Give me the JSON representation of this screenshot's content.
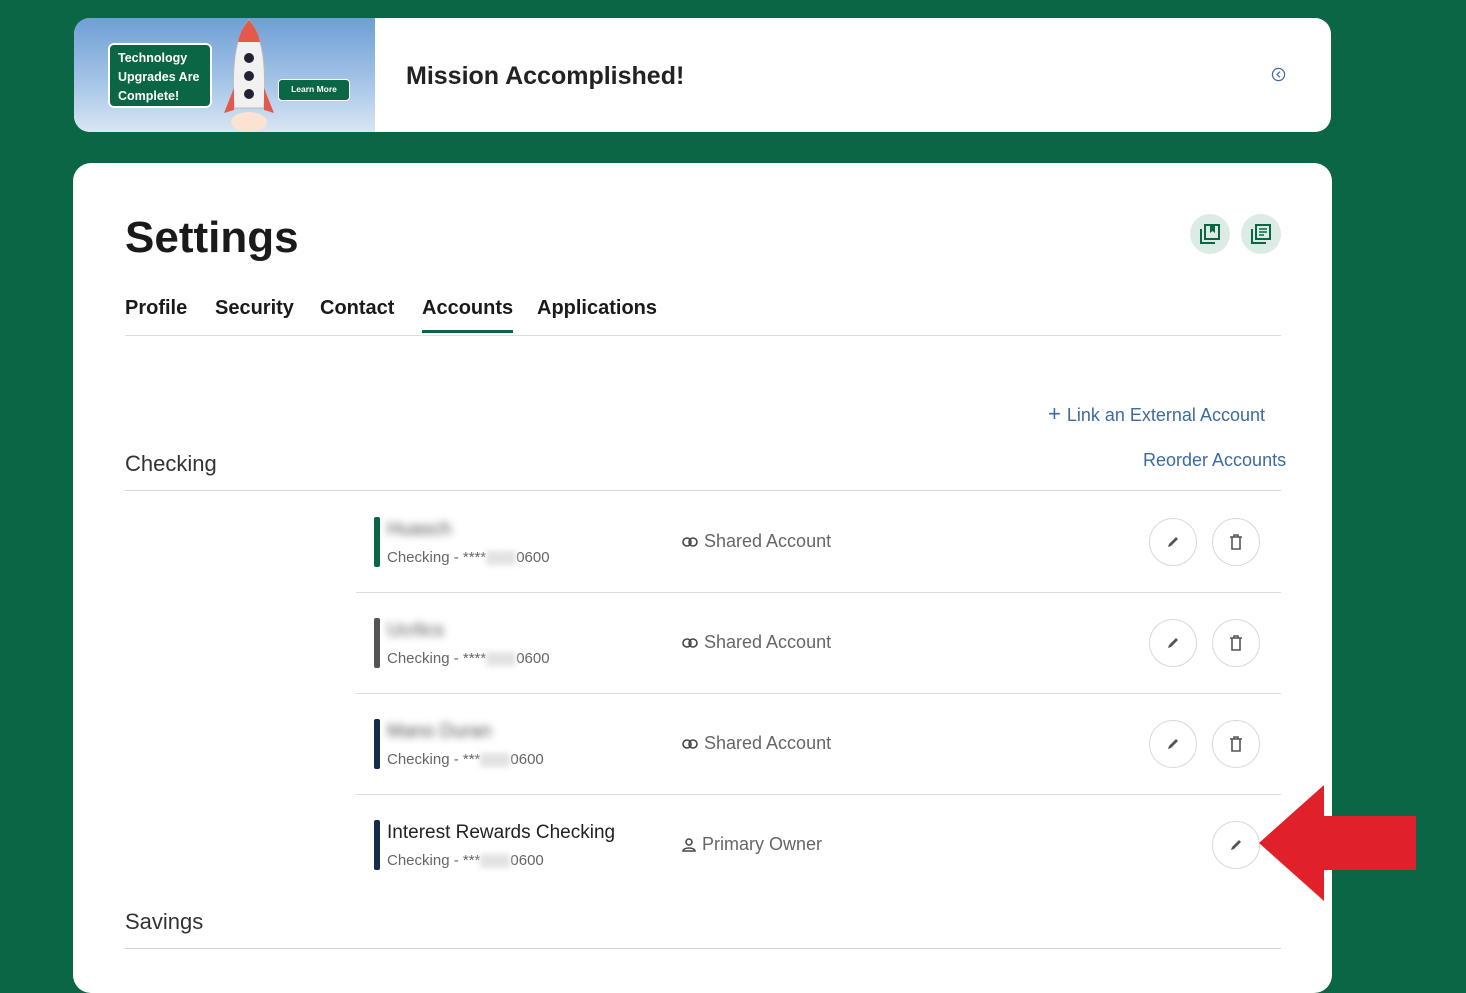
{
  "banner": {
    "ad_text": "Technology Upgrades Are Complete!",
    "ad_button": "Learn More",
    "title": "Mission Accomplished!"
  },
  "settings": {
    "title": "Settings",
    "tabs": [
      {
        "label": "Profile",
        "active": false
      },
      {
        "label": "Security",
        "active": false
      },
      {
        "label": "Contact",
        "active": false
      },
      {
        "label": "Accounts",
        "active": true
      },
      {
        "label": "Applications",
        "active": false
      }
    ],
    "link_external": "Link an External Account",
    "reorder": "Reorder Accounts"
  },
  "sections": {
    "checking": "Checking",
    "savings": "Savings"
  },
  "accounts": [
    {
      "name": "Huasch",
      "type_prefix": "Checking - ****",
      "last4": "0600",
      "relation": "Shared Account",
      "bar_color": "#0b6645"
    },
    {
      "name": "Ucrlics",
      "type_prefix": "Checking - ****",
      "last4": "0600",
      "relation": "Shared Account",
      "bar_color": "#555555"
    },
    {
      "name": "Mano Duran",
      "type_prefix": "Checking - ***",
      "last4": "0600",
      "relation": "Shared Account",
      "bar_color": "#142b4a"
    },
    {
      "name": "Interest Rewards Checking",
      "type_prefix": "Checking - ***",
      "last4": "0600",
      "relation": "Primary Owner",
      "bar_color": "#142b4a"
    }
  ],
  "colors": {
    "accent": "#0b6645",
    "link": "#3d6aa1",
    "arrow": "#e0202a"
  }
}
